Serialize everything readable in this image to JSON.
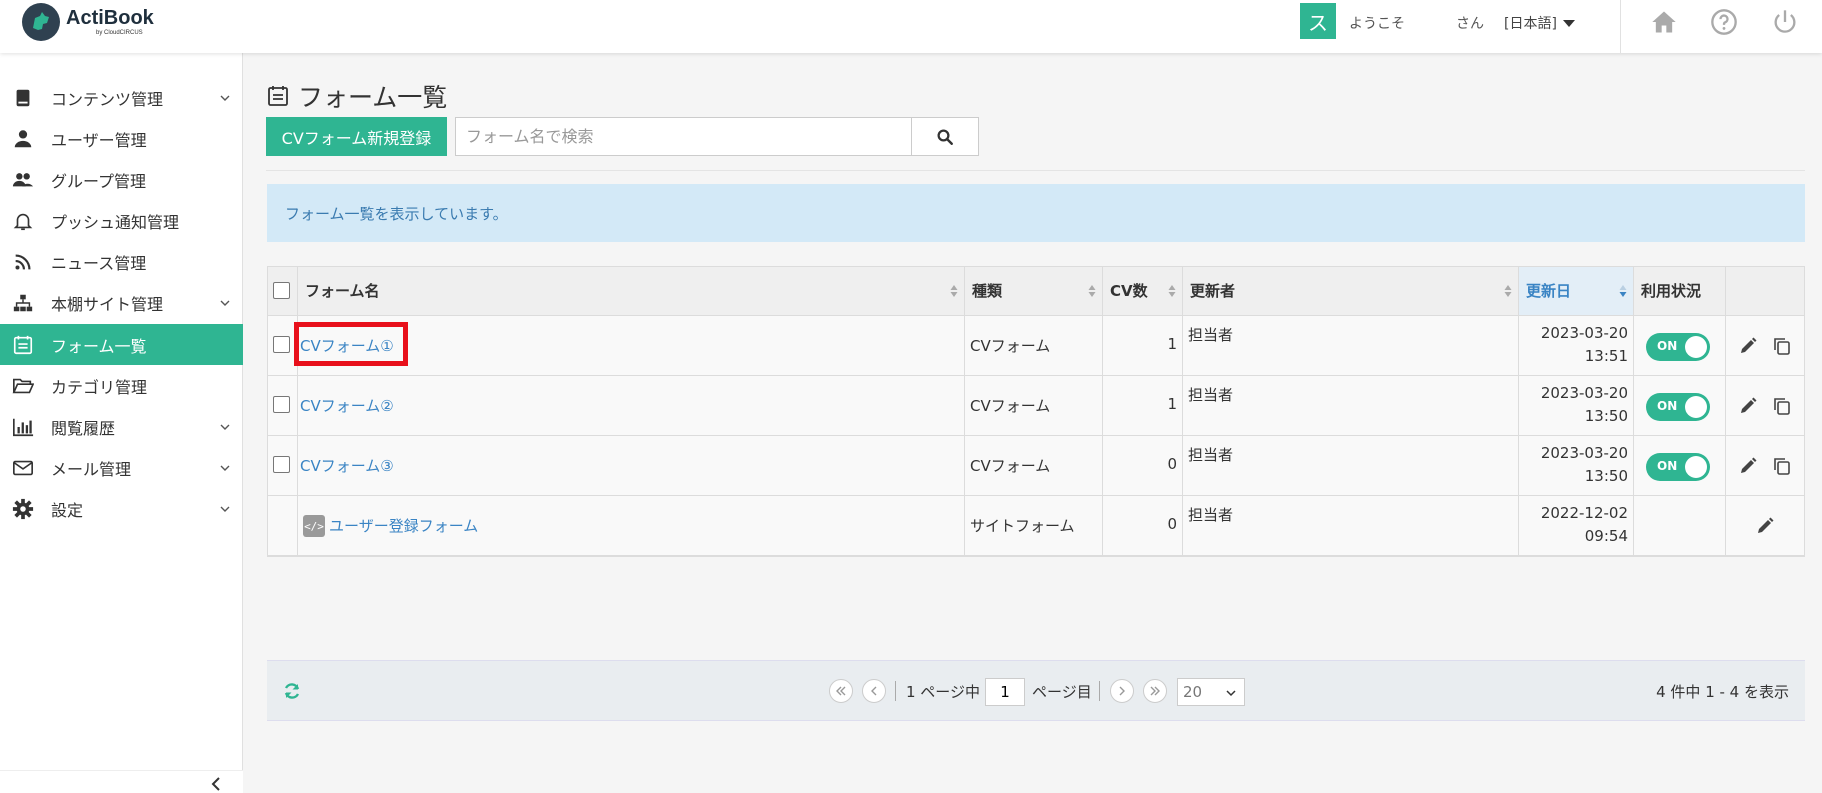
{
  "header": {
    "logo_name": "ActiBook",
    "logo_sub": "by CloudCIRCUS",
    "avatar_initial": "ス",
    "welcome": "ようこそ",
    "user_suffix": "さん",
    "language": "[日本語]"
  },
  "sidebar": {
    "items": [
      {
        "label": "コンテンツ管理",
        "icon": "book-icon",
        "expandable": true
      },
      {
        "label": "ユーザー管理",
        "icon": "user-icon",
        "expandable": false
      },
      {
        "label": "グループ管理",
        "icon": "users-icon",
        "expandable": false
      },
      {
        "label": "プッシュ通知管理",
        "icon": "bell-icon",
        "expandable": false
      },
      {
        "label": "ニュース管理",
        "icon": "rss-icon",
        "expandable": false
      },
      {
        "label": "本棚サイト管理",
        "icon": "sitemap-icon",
        "expandable": true
      },
      {
        "label": "フォーム一覧",
        "icon": "form-icon",
        "expandable": false,
        "active": true
      },
      {
        "label": "カテゴリ管理",
        "icon": "folder-icon",
        "expandable": false
      },
      {
        "label": "閲覧履歴",
        "icon": "bar-chart-icon",
        "expandable": true
      },
      {
        "label": "メール管理",
        "icon": "envelope-icon",
        "expandable": true
      },
      {
        "label": "設定",
        "icon": "gear-icon",
        "expandable": true
      }
    ]
  },
  "main": {
    "title": "フォーム一覧",
    "new_button": "CVフォーム新規登録",
    "search_placeholder": "フォーム名で検索",
    "info_message": "フォーム一覧を表示しています。"
  },
  "table": {
    "columns": [
      "フォーム名",
      "種類",
      "CV数",
      "更新者",
      "更新日",
      "利用状況"
    ],
    "rows": [
      {
        "name": "CVフォーム①",
        "type": "CVフォーム",
        "cv": "1",
        "updater": "担当者",
        "date": "2023-03-20",
        "time": "13:51",
        "status": "ON",
        "kind": "cv"
      },
      {
        "name": "CVフォーム②",
        "type": "CVフォーム",
        "cv": "1",
        "updater": "担当者",
        "date": "2023-03-20",
        "time": "13:50",
        "status": "ON",
        "kind": "cv"
      },
      {
        "name": "CVフォーム③",
        "type": "CVフォーム",
        "cv": "0",
        "updater": "担当者",
        "date": "2023-03-20",
        "time": "13:50",
        "status": "ON",
        "kind": "cv"
      },
      {
        "name": "ユーザー登録フォーム",
        "type": "サイトフォーム",
        "cv": "0",
        "updater": "担当者",
        "date": "2022-12-02",
        "time": "09:54",
        "status": "",
        "kind": "site"
      }
    ]
  },
  "pagination": {
    "page_prefix": "1 ページ中",
    "current_page": "1",
    "page_suffix": "ページ目",
    "per_page": "20",
    "total_text": "4 件中 1 - 4 を表示"
  },
  "colors": {
    "accent": "#2fb592",
    "link": "#3a84c4",
    "info_bg": "#d3e9f7",
    "highlight": "#e8101b"
  }
}
